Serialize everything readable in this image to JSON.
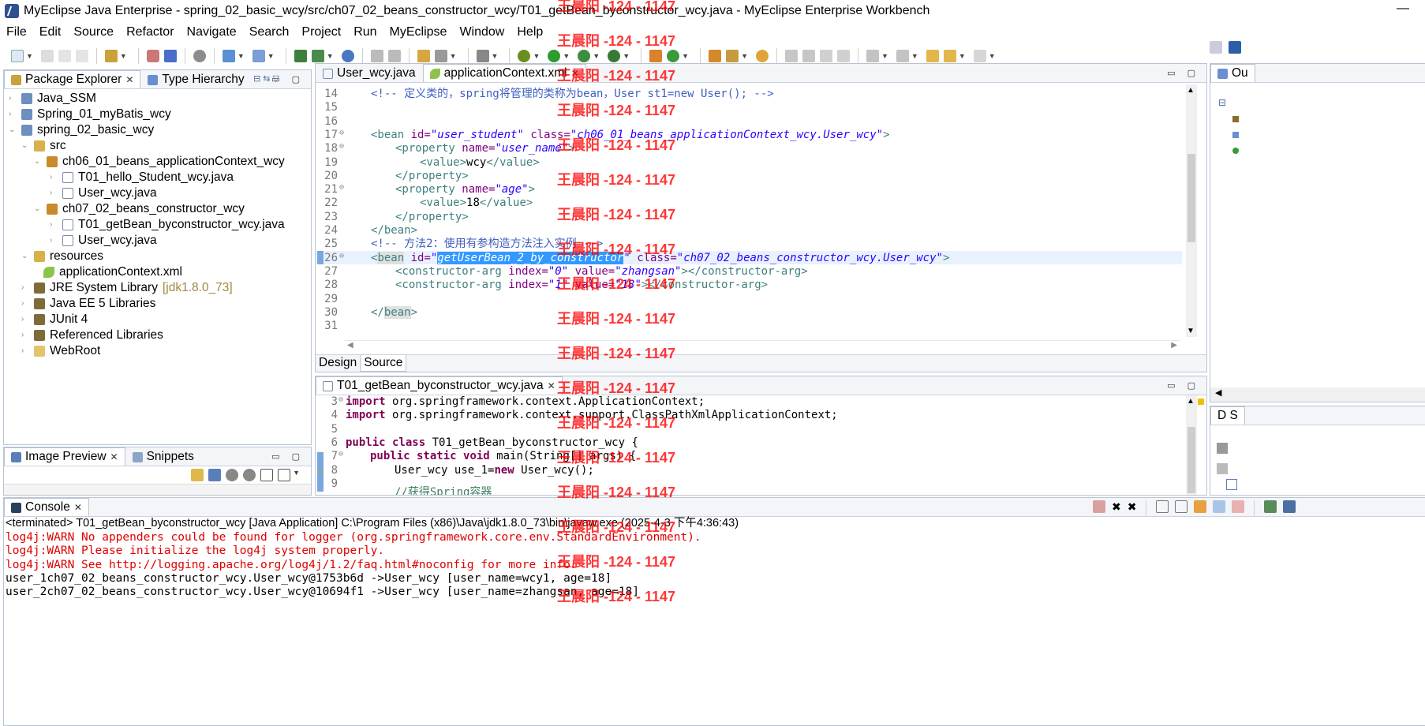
{
  "window": {
    "title": "MyEclipse Java Enterprise - spring_02_basic_wcy/src/ch07_02_beans_constructor_wcy/T01_getBean_byconstructor_wcy.java - MyEclipse Enterprise Workbench",
    "minimize": "—"
  },
  "menu": [
    "File",
    "Edit",
    "Source",
    "Refactor",
    "Navigate",
    "Search",
    "Project",
    "Run",
    "MyEclipse",
    "Window",
    "Help"
  ],
  "package_explorer": {
    "tab_label": "Package Explorer",
    "tab2_label": "Type Hierarchy",
    "items": [
      {
        "label": "Java_SSM",
        "icon": "project-icon"
      },
      {
        "label": "Spring_01_myBatis_wcy",
        "icon": "project-icon"
      },
      {
        "label": "spring_02_basic_wcy",
        "icon": "project-icon"
      },
      {
        "label": "src",
        "icon": "source-folder-icon"
      },
      {
        "label": "ch06_01_beans_applicationContext_wcy",
        "icon": "package-icon"
      },
      {
        "label": "T01_hello_Student_wcy.java",
        "icon": "java-file-icon"
      },
      {
        "label": "User_wcy.java",
        "icon": "java-file-icon"
      },
      {
        "label": "ch07_02_beans_constructor_wcy",
        "icon": "package-icon"
      },
      {
        "label": "T01_getBean_byconstructor_wcy.java",
        "icon": "java-file-icon"
      },
      {
        "label": "User_wcy.java",
        "icon": "java-file-icon"
      },
      {
        "label": "resources",
        "icon": "source-folder-icon"
      },
      {
        "label": "applicationContext.xml",
        "icon": "xml-file-icon"
      },
      {
        "label": "JRE System Library",
        "suffix": "[jdk1.8.0_73]",
        "icon": "library-icon"
      },
      {
        "label": "Java EE 5 Libraries",
        "icon": "library-icon"
      },
      {
        "label": "JUnit 4",
        "icon": "library-icon"
      },
      {
        "label": "Referenced Libraries",
        "icon": "library-icon"
      },
      {
        "label": "WebRoot",
        "icon": "folder-icon"
      }
    ]
  },
  "image_preview": {
    "tab_label": "Image Preview",
    "tab2_label": "Snippets"
  },
  "xml_editor": {
    "tabs": [
      "User_wcy.java",
      "applicationContext.xml"
    ],
    "bottom_tabs": [
      "Design",
      "Source"
    ],
    "line_numbers": [
      "14",
      "15",
      "16",
      "17",
      "18",
      "19",
      "20",
      "21",
      "22",
      "23",
      "24",
      "25",
      "26",
      "27",
      "28",
      "29",
      "30",
      "31"
    ],
    "lines": {
      "l14": "<!-- 定义类的，spring将管理的类称为bean，User st1=new User(); -->",
      "l17_tag": "<bean ",
      "l17_a1": "id=",
      "l17_v1": "\"user_student\"",
      "l17_a2": " class=",
      "l17_v2": "\"ch06_01_beans_applicationContext_wcy.User_wcy\"",
      "l17_end": ">",
      "l18_tag": "<property ",
      "l18_a": "name=",
      "l18_v": "\"user_name\"",
      "l18_end": ">",
      "l19_open": "<value>",
      "l19_text": "wcy",
      "l19_close": "</value>",
      "l20": "</property>",
      "l21_tag": "<property ",
      "l21_a": "name=",
      "l21_v": "\"age\"",
      "l21_end": ">",
      "l22_open": "<value>",
      "l22_text": "18",
      "l22_close": "</value>",
      "l23": "</property>",
      "l24": "</bean>",
      "l25": "<!-- 方法2：使用有参构造方法注入实例 -->",
      "l26_lt": "<",
      "l26_tag": "bean",
      "l26_a1": " id=",
      "l26_q1": "\"",
      "l26_v1": "getUserBean_2_by_constructor",
      "l26_q2": "\"",
      "l26_a2": " class=",
      "l26_v2": "\"ch07_02_beans_constructor_wcy.User_wcy\"",
      "l26_end": ">",
      "l27_tag": "<constructor-arg ",
      "l27_a1": "index=",
      "l27_v1": "\"0\"",
      "l27_a2": " value=",
      "l27_v2": "\"zhangsan\"",
      "l27_end": "></constructor-arg>",
      "l28_tag": "<constructor-arg ",
      "l28_a1": "index=",
      "l28_v1": "\"1\"",
      "l28_a2": " value=",
      "l28_v2": "\"18\"",
      "l28_end": "></constructor-arg>",
      "l30_lt": "</",
      "l30_tag": "bean",
      "l30_end": ">"
    }
  },
  "java_editor": {
    "tab_label": "T01_getBean_byconstructor_wcy.java",
    "line_numbers": [
      "3",
      "4",
      "5",
      "6",
      "7",
      "8",
      "9"
    ],
    "l3_kw": "import",
    "l3_rest": " org.springframework.context.ApplicationContext;",
    "l4_kw": "import",
    "l4_rest": " org.springframework.context.support.ClassPathXmlApplicationContext;",
    "l6_kw1": "public",
    "l6_kw2": " class",
    "l6_rest": " T01_getBean_byconstructor_wcy {",
    "l7_kw1": "public",
    "l7_kw2": " static",
    "l7_kw3": " void",
    "l7_rest": " main(String[] args) {",
    "l8_a": "User_wcy use_1=",
    "l8_kw": "new",
    "l8_b": " User_wcy();",
    "l9": "//获得Spring容器"
  },
  "console": {
    "tab_label": "Console",
    "header": "<terminated> T01_getBean_byconstructor_wcy [Java Application] C:\\Program Files (x86)\\Java\\jdk1.8.0_73\\bin\\javaw.exe (2025-4-3 下午4:36:43)",
    "lines": [
      {
        "text": "log4j:WARN No appenders could be found for logger (org.springframework.core.env.StandardEnvironment).",
        "color": "#e00000"
      },
      {
        "text": "log4j:WARN Please initialize the log4j system properly.",
        "color": "#e00000"
      },
      {
        "text": "log4j:WARN See http://logging.apache.org/log4j/1.2/faq.html#noconfig for more info.",
        "color": "#e00000"
      },
      {
        "text": "user_1ch07_02_beans_constructor_wcy.User_wcy@1753b6d ->User_wcy [user_name=wcy1, age=18]",
        "color": "#000000"
      },
      {
        "text": "user_2ch07_02_beans_constructor_wcy.User_wcy@10694f1 ->User_wcy [user_name=zhangsan, age=18]",
        "color": "#000000"
      }
    ]
  },
  "outline": {
    "tab_label": "Ou",
    "tab2_label": "D S"
  },
  "watermark": "王晨阳 -124 - 1147"
}
